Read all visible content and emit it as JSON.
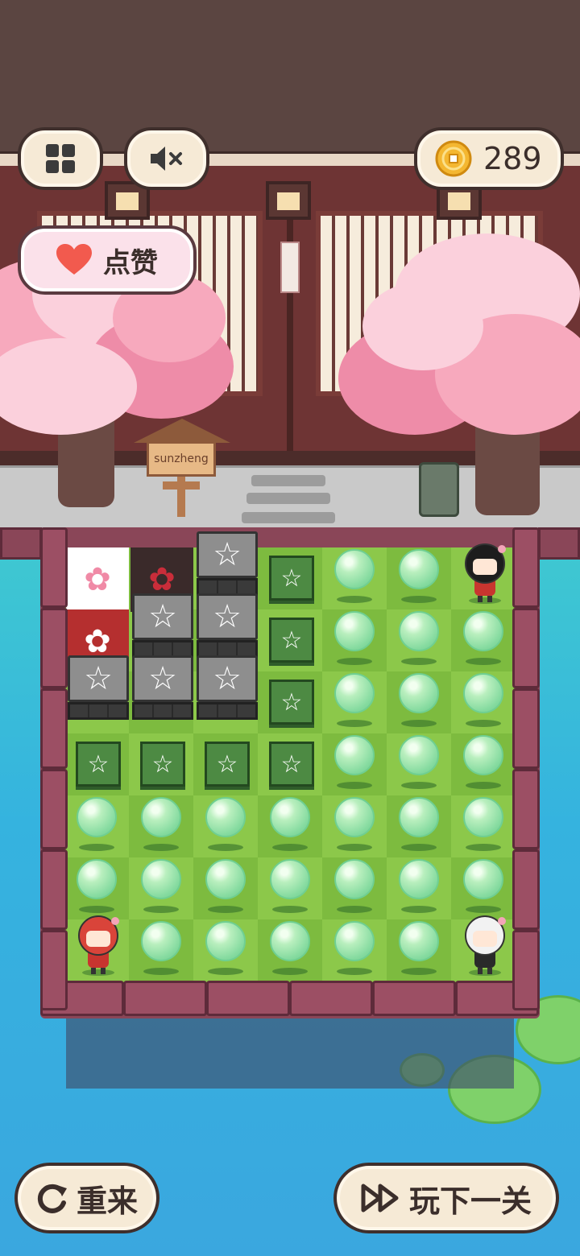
{
  "header": {
    "menu_icon": "grid-icon",
    "sound_icon": "sound-muted-icon",
    "coin_icon": "coin-icon",
    "coins": "289"
  },
  "like_button": {
    "icon": "heart-icon",
    "label": "点赞"
  },
  "sign": {
    "text": "sunzheng"
  },
  "board": {
    "columns": 7,
    "rows": 7,
    "legend": "B=bubble, R=stone block, G=green star box, W=white flower tile, D=dark flower tile, F=red flower tile, C=character",
    "cells": [
      [
        "W",
        "D",
        "R",
        "G",
        "B",
        "B",
        "C"
      ],
      [
        "F",
        "R",
        "R",
        "G",
        "B",
        "B",
        "B"
      ],
      [
        "R",
        "R",
        "R",
        "G",
        "B",
        "B",
        "B"
      ],
      [
        "G",
        "G",
        "G",
        "G",
        "B",
        "B",
        "B"
      ],
      [
        "B",
        "B",
        "B",
        "B",
        "B",
        "B",
        "B"
      ],
      [
        "B",
        "B",
        "B",
        "B",
        "B",
        "B",
        "B"
      ],
      [
        "C",
        "B",
        "B",
        "B",
        "B",
        "B",
        "C"
      ]
    ],
    "characters": [
      {
        "name": "black-hair-girl",
        "row": 0,
        "col": 6
      },
      {
        "name": "red-hair-girl",
        "row": 6,
        "col": 0
      },
      {
        "name": "white-hair-girl",
        "row": 6,
        "col": 6
      }
    ],
    "star_glyph": "☆",
    "flower_glyph": "✿"
  },
  "footer": {
    "restart": {
      "icon": "restart-icon",
      "label": "重来"
    },
    "next": {
      "icon": "fast-forward-icon",
      "label": "玩下一关"
    }
  },
  "colors": {
    "accent": "#f25a4e",
    "coin": "#f4b731",
    "grass": "#8cc84a",
    "water": "#3fb8dc"
  }
}
